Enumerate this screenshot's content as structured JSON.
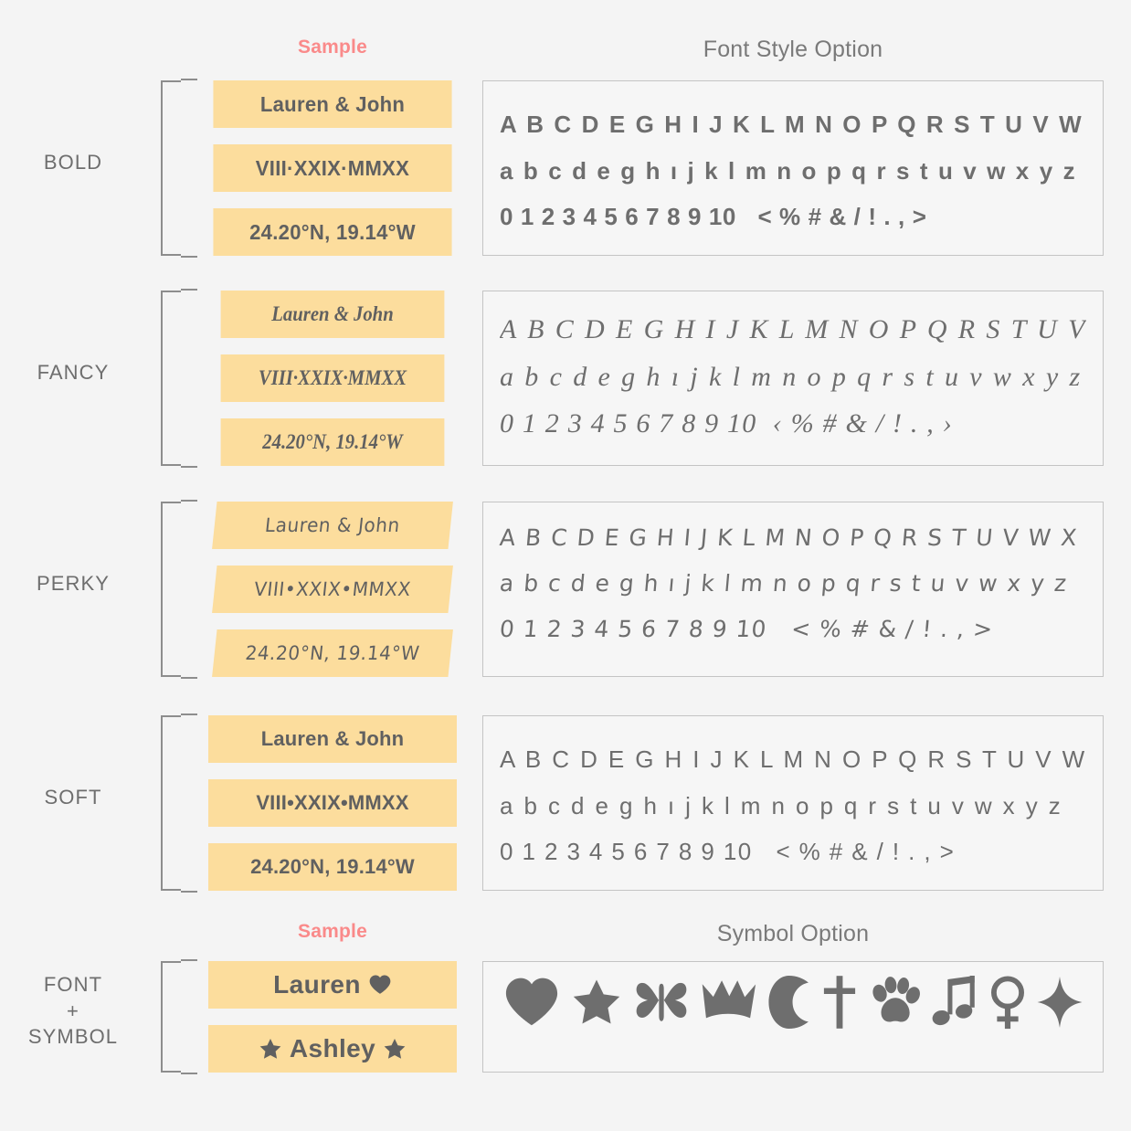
{
  "colors": {
    "background": "#f4f4f4",
    "chip": "#fcdd9d",
    "text": "#606060",
    "glyph": "#6e6e6e",
    "label": "#6e6e6e",
    "accent": "#fa8a8a",
    "panel_border": "#c4c4c4",
    "bracket": "#8d8d8d"
  },
  "headers": {
    "top_sample": "Sample",
    "top_main": "Font Style Option",
    "bottom_sample": "Sample",
    "bottom_main": "Symbol Option"
  },
  "sections": [
    {
      "label": "BOLD",
      "samples": [
        "Lauren & John",
        "VIII·XXIX·MMXX",
        "24.20°N, 19.14°W"
      ],
      "glyphs": {
        "uppercase": "A B C D E G H I J K L M N O P Q R S T U V W X Y Z",
        "lowercase": "a b c d e g h ı j k l m n o p q r s t u v w x y z",
        "numbers": "0 1 2 3 4 5 6 7 8 9 10",
        "symbols": "< % # & / ! . , >"
      }
    },
    {
      "label": "FANCY",
      "samples": [
        "Lauren & John",
        "VIII·XXIX·MMXX",
        "24.20°N, 19.14°W"
      ],
      "glyphs": {
        "uppercase": "A B C D E G H I J K L M N O P Q R S T U V W X Y Z",
        "lowercase": "a b c d e g h ı j k l m n o p q r s t u v w x y z",
        "numbers": "0 1 2 3 4 5 6 7 8 9 10",
        "symbols": "‹ % # & / ! . , ›"
      }
    },
    {
      "label": "PERKY",
      "samples": [
        "Lauren & John",
        "VIII•XXIX•MMXX",
        "24.20°N, 19.14°W"
      ],
      "glyphs": {
        "uppercase": "A B C D E G H I J K L M N O P Q R S T U V W X Y Z",
        "lowercase": "a b c d e g h ı j k l m n o p q r s t u v w x y z",
        "numbers": "0 1 2 3 4 5 6 7 8 9 10",
        "symbols": "< % # & / ! . , >"
      }
    },
    {
      "label": "SOFT",
      "samples": [
        "Lauren & John",
        "VIII•XXIX•MMXX",
        "24.20°N, 19.14°W"
      ],
      "glyphs": {
        "uppercase": "A B C D E G H I J K L M N O P Q R S T U V W X Y Z",
        "lowercase": "a b c d e g h ı j k l m n o p q r s t u v w x y z",
        "numbers": "0 1 2 3 4 5 6 7 8 9 10",
        "symbols": "< % # & / ! . , >"
      }
    }
  ],
  "font_symbol": {
    "label_line1": "FONT",
    "label_line2": "+",
    "label_line3": "SYMBOL",
    "sample_1_text": "Lauren",
    "sample_1_symbol": "heart",
    "sample_2_text": "Ashley",
    "sample_2_symbol_left": "star",
    "sample_2_symbol_right": "star"
  },
  "symbol_options": [
    {
      "name": "heart-symbol"
    },
    {
      "name": "star-symbol"
    },
    {
      "name": "butterfly-symbol"
    },
    {
      "name": "crown-symbol"
    },
    {
      "name": "moon-symbol"
    },
    {
      "name": "cross-symbol"
    },
    {
      "name": "paw-symbol"
    },
    {
      "name": "music-note-symbol"
    },
    {
      "name": "venus-symbol"
    },
    {
      "name": "sparkle-symbol"
    }
  ]
}
